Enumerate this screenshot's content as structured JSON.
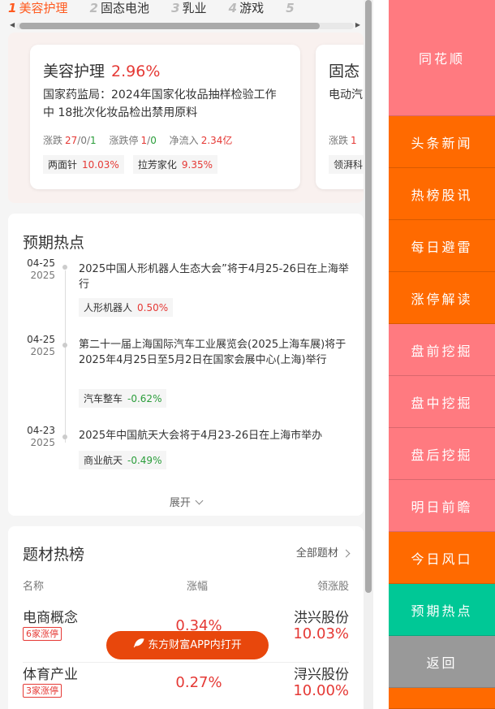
{
  "tabs": [
    {
      "num": "1",
      "label": "美容护理",
      "active": true
    },
    {
      "num": "2",
      "label": "固态电池",
      "active": false
    },
    {
      "num": "3",
      "label": "乳业",
      "active": false
    },
    {
      "num": "4",
      "label": "游戏",
      "active": false
    },
    {
      "num": "5",
      "label": "",
      "active": false
    }
  ],
  "sector_cards": [
    {
      "name": "美容护理",
      "pct": "2.96%",
      "desc": "国家药监局：2024年国家化妆品抽样检验工作中 18批次化妆品检出禁用原料",
      "zd_label": "涨跌",
      "zd_up": "27",
      "zd_flat": "0",
      "zd_down": "1",
      "zt_label": "涨跌停",
      "zt_up": "1",
      "zt_down": "0",
      "inflow_label": "净流入",
      "inflow": "2.34亿",
      "stocks": [
        {
          "name": "两面针",
          "pct": "10.03%"
        },
        {
          "name": "拉芳家化",
          "pct": "9.35%"
        }
      ]
    },
    {
      "name": "固态",
      "pct": "",
      "desc": "电动汽",
      "zd_label": "涨跌",
      "zd_up": "1",
      "zd_flat": "",
      "zd_down": "",
      "zt_label": "",
      "zt_up": "",
      "zt_down": "",
      "inflow_label": "",
      "inflow": "",
      "stocks": [
        {
          "name": "领湃科",
          "pct": ""
        }
      ]
    }
  ],
  "expect": {
    "title": "预期热点",
    "items": [
      {
        "date": "04-25",
        "year": "2025",
        "text": "2025中国人形机器人生态大会”将于4月25-26日在上海举行",
        "tag": "人形机器人",
        "tag_pct": "0.50%",
        "dir": "up"
      },
      {
        "date": "04-25",
        "year": "2025",
        "text": "第二十一届上海国际汽车工业展览会(2025上海车展)将于2025年4月25日至5月2日在国家会展中心(上海)举行",
        "tag": "汽车整车",
        "tag_pct": "-0.62%",
        "dir": "down"
      },
      {
        "date": "04-23",
        "year": "2025",
        "text": "2025年中国航天大会将于4月23-26日在上海市举办",
        "tag": "商业航天",
        "tag_pct": "-0.49%",
        "dir": "down"
      }
    ],
    "expand_label": "展开"
  },
  "hot": {
    "title": "题材热榜",
    "all_label": "全部题材",
    "col_name": "名称",
    "col_pct": "涨幅",
    "col_lead": "领涨股",
    "rows": [
      {
        "name": "电商概念",
        "badge": "6家涨停",
        "pct": "0.34%",
        "lead": "洪兴股份",
        "lead_pct": "10.03%"
      },
      {
        "name": "体育产业",
        "badge": "3家涨停",
        "pct": "0.27%",
        "lead": "浔兴股份",
        "lead_pct": "10.00%"
      }
    ]
  },
  "app_button": "东方财富APP内打开",
  "nav": [
    {
      "label": "同花顺",
      "color": "#ff7a80"
    },
    {
      "label": "头条新闻",
      "color": "#ff6a00"
    },
    {
      "label": "热榜股讯",
      "color": "#ff6a00"
    },
    {
      "label": "每日避雷",
      "color": "#ff6a00"
    },
    {
      "label": "涨停解读",
      "color": "#ff6a00"
    },
    {
      "label": "盘前挖掘",
      "color": "#ff7a80"
    },
    {
      "label": "盘中挖掘",
      "color": "#ff7a80"
    },
    {
      "label": "盘后挖掘",
      "color": "#ff7a80"
    },
    {
      "label": "明日前瞻",
      "color": "#ff7a80"
    },
    {
      "label": "今日风口",
      "color": "#ff6a00"
    },
    {
      "label": "预期热点",
      "color": "#00c896"
    },
    {
      "label": "返回",
      "color": "#999999"
    },
    {
      "label": "",
      "color": "#ff6a00"
    }
  ]
}
